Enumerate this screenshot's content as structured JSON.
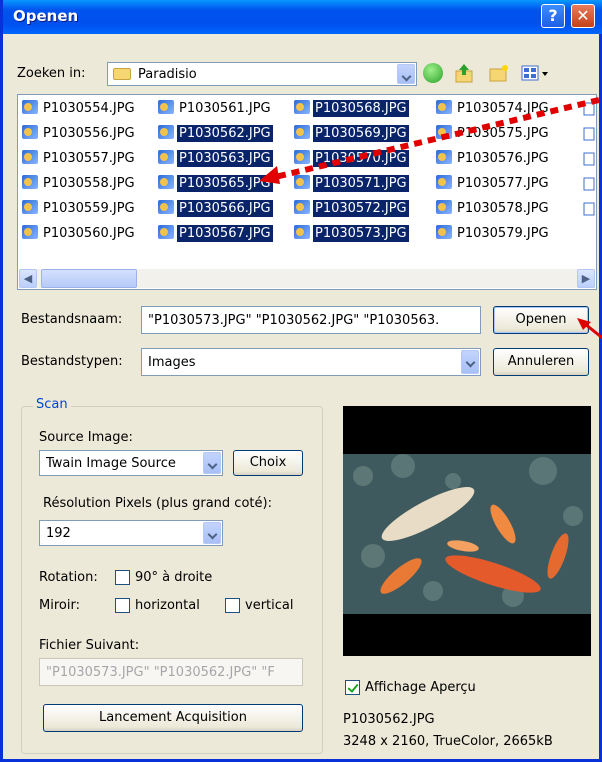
{
  "window": {
    "title": "Openen"
  },
  "lookin": {
    "label": "Zoeken in:",
    "value": "Paradisio"
  },
  "files": {
    "columns": [
      [
        {
          "name": "P1030554.JPG",
          "sel": false
        },
        {
          "name": "P1030556.JPG",
          "sel": false
        },
        {
          "name": "P1030557.JPG",
          "sel": false
        },
        {
          "name": "P1030558.JPG",
          "sel": false
        },
        {
          "name": "P1030559.JPG",
          "sel": false
        },
        {
          "name": "P1030560.JPG",
          "sel": false
        }
      ],
      [
        {
          "name": "P1030561.JPG",
          "sel": false
        },
        {
          "name": "P1030562.JPG",
          "sel": true
        },
        {
          "name": "P1030563.JPG",
          "sel": true
        },
        {
          "name": "P1030565.JPG",
          "sel": true
        },
        {
          "name": "P1030566.JPG",
          "sel": true
        },
        {
          "name": "P1030567.JPG",
          "sel": true
        }
      ],
      [
        {
          "name": "P1030568.JPG",
          "sel": true
        },
        {
          "name": "P1030569.JPG",
          "sel": true
        },
        {
          "name": "P1030570.JPG",
          "sel": true
        },
        {
          "name": "P1030571.JPG",
          "sel": true
        },
        {
          "name": "P1030572.JPG",
          "sel": true
        },
        {
          "name": "P1030573.JPG",
          "sel": true,
          "focus": true
        }
      ],
      [
        {
          "name": "P1030574.JPG",
          "sel": false
        },
        {
          "name": "P1030575.JPG",
          "sel": false
        },
        {
          "name": "P1030576.JPG",
          "sel": false
        },
        {
          "name": "P1030577.JPG",
          "sel": false
        },
        {
          "name": "P1030578.JPG",
          "sel": false
        },
        {
          "name": "P1030579.JPG",
          "sel": false
        }
      ]
    ]
  },
  "filename": {
    "label": "Bestandsnaam:",
    "value": "\"P1030573.JPG\" \"P1030562.JPG\" \"P1030563."
  },
  "filetype": {
    "label": "Bestandstypen:",
    "value": "Images"
  },
  "buttons": {
    "open": "Openen",
    "cancel": "Annuleren"
  },
  "scan": {
    "group_title": "Scan",
    "source_label": "Source Image:",
    "source_value": "Twain Image Source",
    "choose_button": "Choix",
    "resolution_label": "Résolution Pixels (plus grand coté):",
    "resolution_value": "192",
    "rotation_label": "Rotation:",
    "rotation_option": "90° à droite",
    "mirror_label": "Miroir:",
    "mirror_horizontal": "horizontal",
    "mirror_vertical": "vertical",
    "next_file_label": "Fichier Suivant:",
    "next_file_value": "\"P1030573.JPG\" \"P1030562.JPG\" \"F",
    "acquire_button": "Lancement Acquisition"
  },
  "preview": {
    "show_label": "Affichage Aperçu",
    "show_checked": true,
    "file_name": "P1030562.JPG",
    "file_info": "3248 x 2160, TrueColor, 2665kB"
  },
  "colors": {
    "selection": "#0a246a",
    "title_bar": "#0053ee",
    "annotation_arrow": "#e00000"
  }
}
